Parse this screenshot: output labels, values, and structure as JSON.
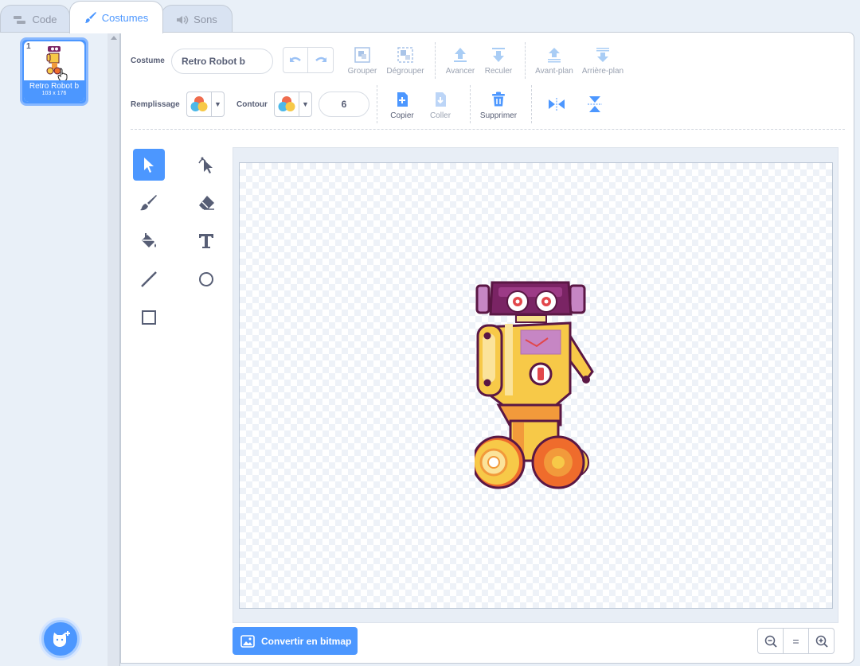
{
  "tabs": [
    {
      "label": "Code",
      "icon": "code-icon"
    },
    {
      "label": "Costumes",
      "icon": "brush-icon"
    },
    {
      "label": "Sons",
      "icon": "speaker-icon"
    }
  ],
  "costume_list": {
    "items": [
      {
        "number": "1",
        "name": "Retro Robot b",
        "size": "103 x 176"
      }
    ]
  },
  "editor": {
    "costume_label": "Costume",
    "costume_name": "Retro Robot b",
    "toolbar": {
      "group": "Grouper",
      "ungroup": "Dégrouper",
      "forward": "Avancer",
      "backward": "Reculer",
      "front": "Avant-plan",
      "back": "Arrière-plan",
      "copy": "Copier",
      "paste": "Coller",
      "delete": "Supprimer"
    },
    "fill_label": "Remplissage",
    "outline_label": "Contour",
    "outline_width": "6",
    "convert_button": "Convertir en bitmap",
    "zoom_reset": "="
  },
  "colors": {
    "accent": "#4c97ff",
    "robot_purple": "#7a2464",
    "robot_yellow": "#f7c948",
    "robot_orange": "#f29a3b"
  }
}
